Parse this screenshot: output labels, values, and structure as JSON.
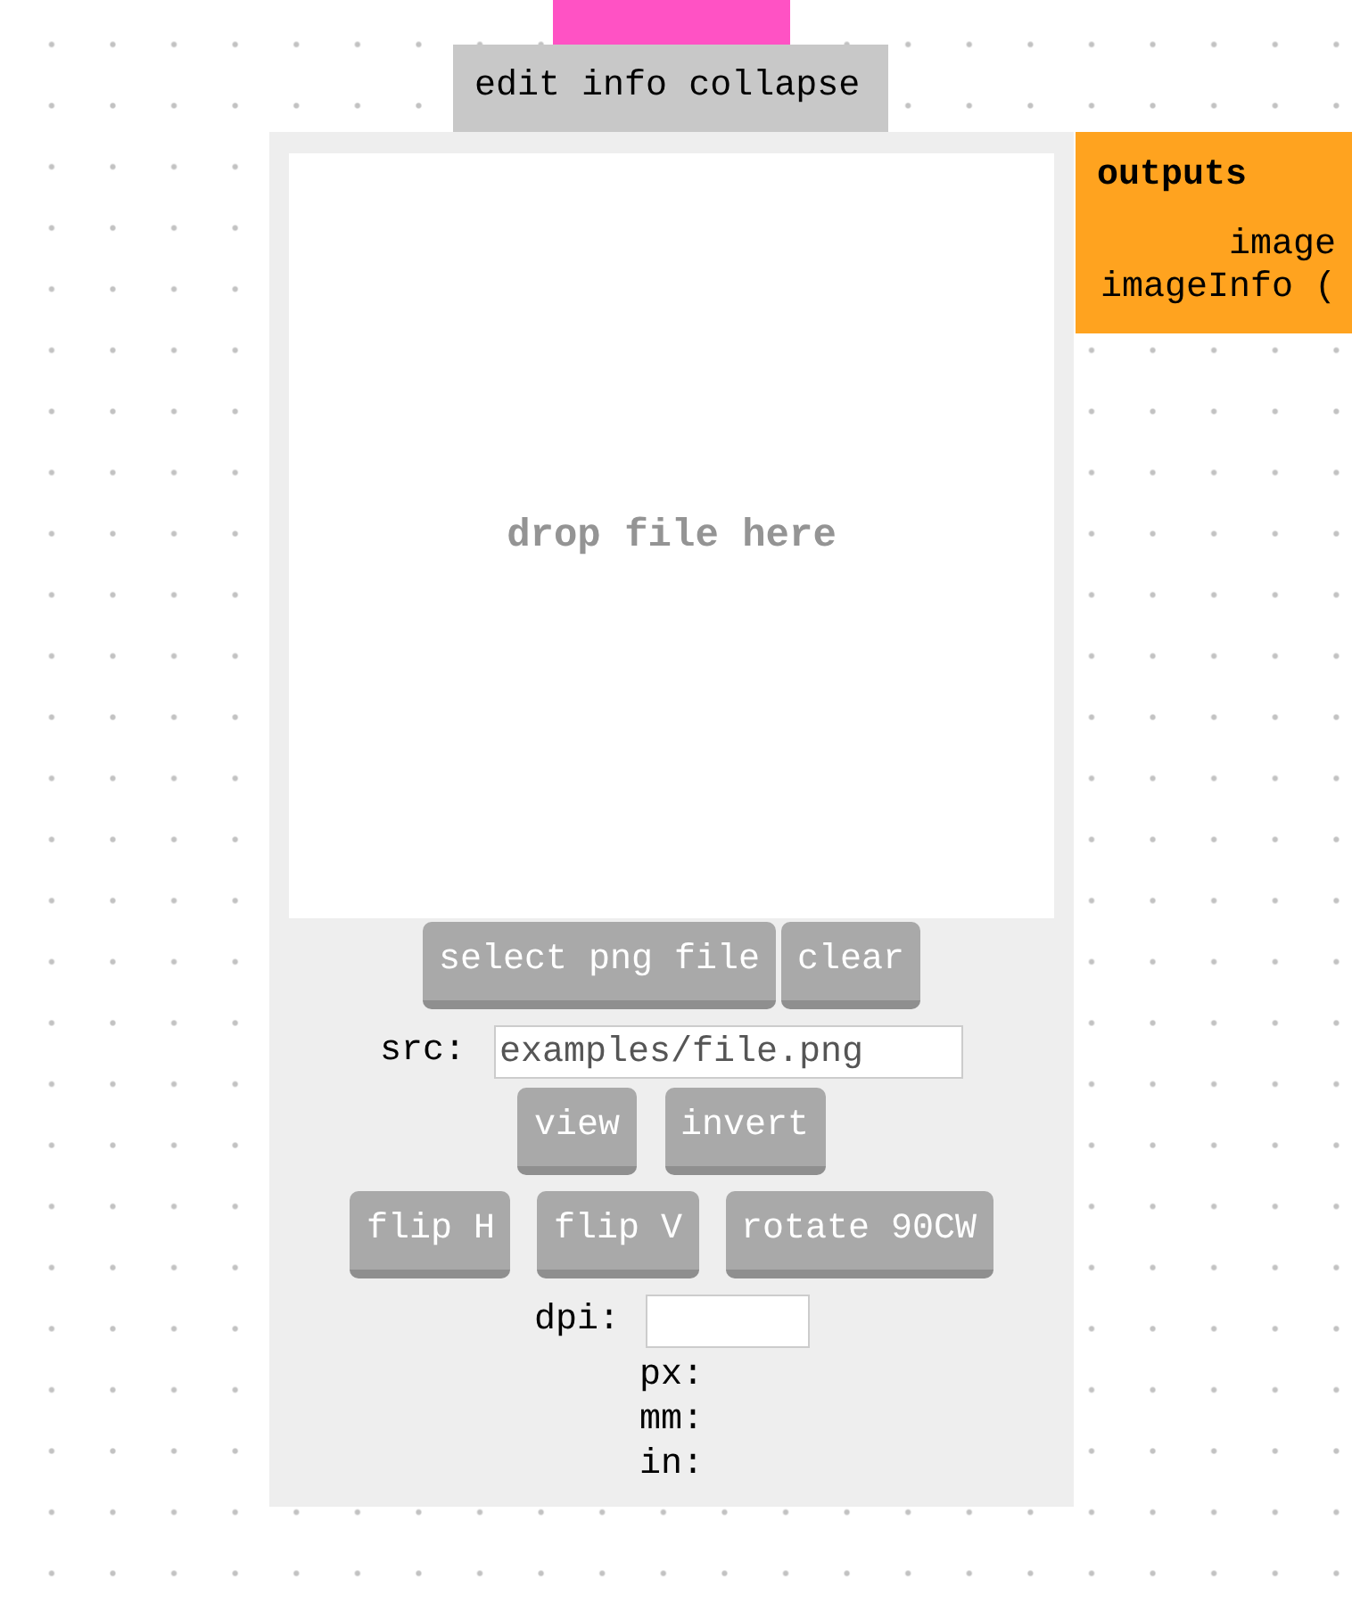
{
  "module": {
    "menu": [
      {
        "label": "edit"
      },
      {
        "label": "info"
      },
      {
        "label": "collapse"
      }
    ],
    "drop_zone": {
      "text": "drop file here"
    },
    "file_buttons": [
      "select png file",
      "clear"
    ],
    "src": {
      "label": "src:",
      "value": "examples/file.png"
    },
    "view_buttons": [
      "view",
      "invert"
    ],
    "transform_buttons": [
      "flip H",
      "flip V",
      "rotate 90CW"
    ],
    "dpi": {
      "label": "dpi:"
    },
    "size_labels": [
      "px:",
      "mm:",
      "in:"
    ],
    "outputs": {
      "title": "outputs",
      "ports": [
        "image",
        "imageInfo ("
      ]
    }
  }
}
